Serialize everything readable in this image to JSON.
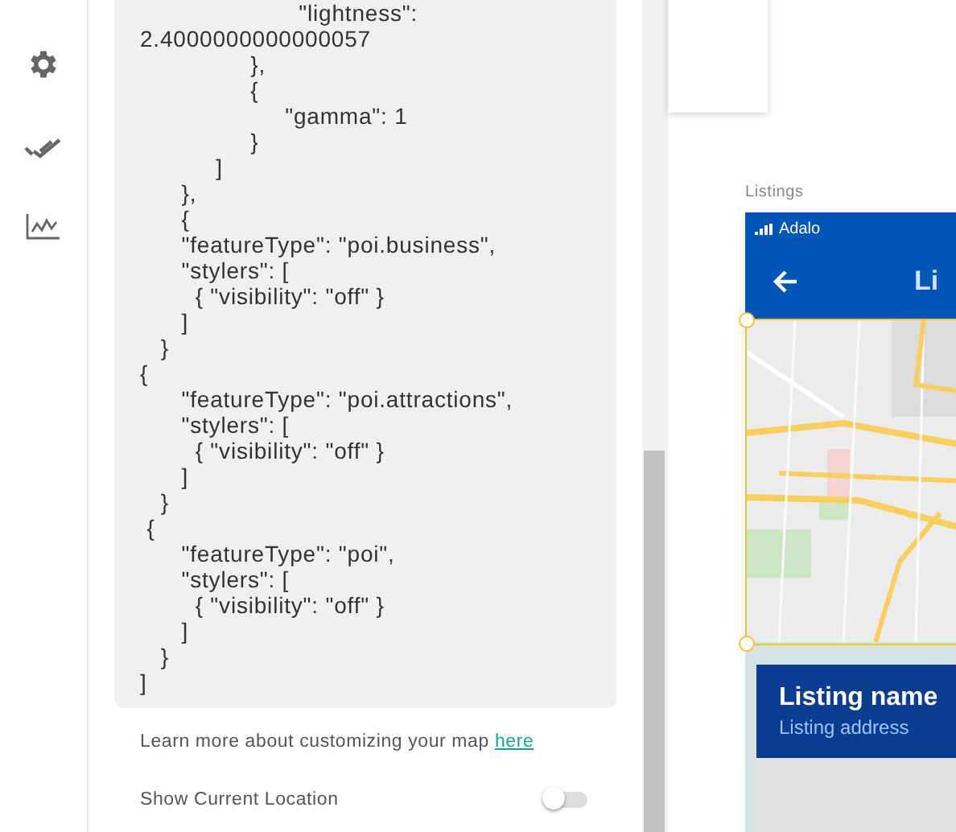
{
  "rail": {
    "items": [
      {
        "kind": "settings"
      },
      {
        "kind": "checks"
      },
      {
        "kind": "analytics"
      }
    ]
  },
  "code_lines": [
    "                       \"lightness\":",
    "2.4000000000000057",
    "                },",
    "                {",
    "                     \"gamma\": 1",
    "                }",
    "           ]",
    "      },",
    "      {",
    "      \"featureType\": \"poi.business\",",
    "      \"stylers\": [",
    "        { \"visibility\": \"off\" }",
    "      ]",
    "   }",
    "{",
    "      \"featureType\": \"poi.attractions\",",
    "      \"stylers\": [",
    "        { \"visibility\": \"off\" }",
    "      ]",
    "   }",
    " {",
    "      \"featureType\": \"poi\",",
    "      \"stylers\": [",
    "        { \"visibility\": \"off\" }",
    "      ]",
    "   }",
    "]"
  ],
  "help": {
    "text": "Learn more about customizing your map",
    "link": "here"
  },
  "show_location": {
    "label": "Show Current Location",
    "on": false
  },
  "screen": {
    "label": "Listings",
    "status_app": "Adalo",
    "header_title": "Li",
    "listing_name": "Listing name",
    "listing_address": "Listing address"
  }
}
